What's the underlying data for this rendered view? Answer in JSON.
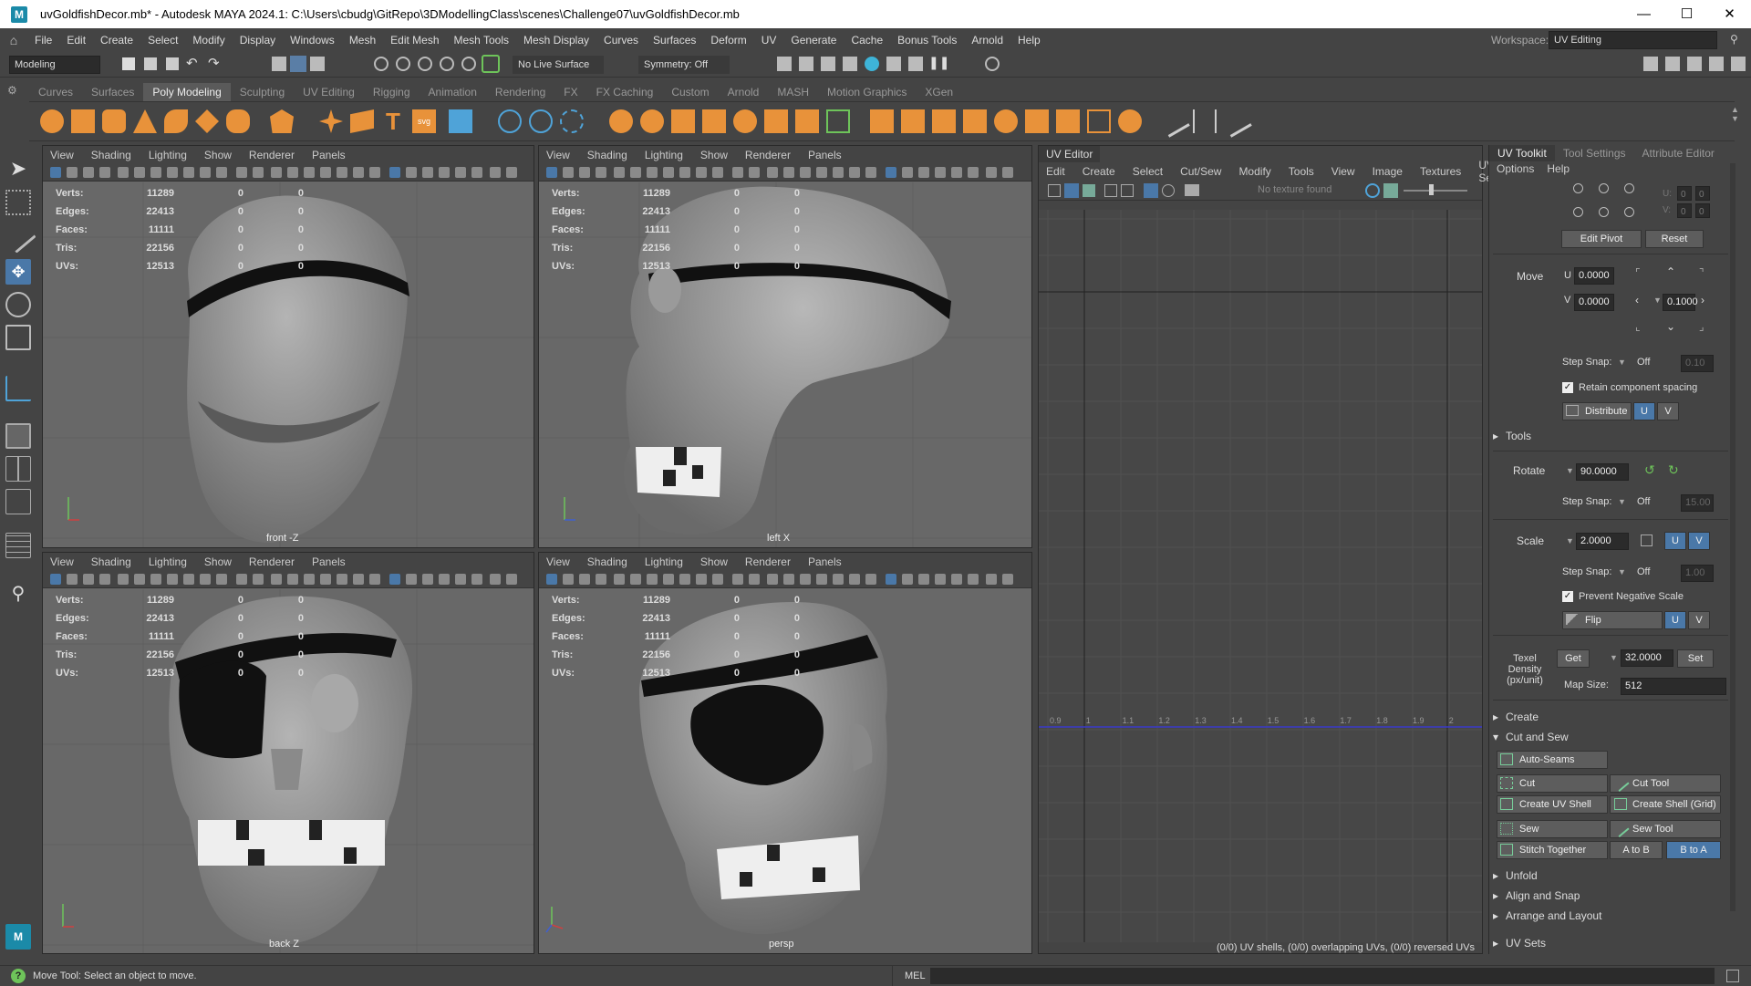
{
  "window": {
    "title": "uvGoldfishDecor.mb* - Autodesk MAYA 2024.1: C:\\Users\\cbudg\\GitRepo\\3DModellingClass\\scenes\\Challenge07\\uvGoldfishDecor.mb",
    "logo": "M"
  },
  "menubar": [
    "File",
    "Edit",
    "Create",
    "Select",
    "Modify",
    "Display",
    "Windows",
    "Mesh",
    "Edit Mesh",
    "Mesh Tools",
    "Mesh Display",
    "Curves",
    "Surfaces",
    "Deform",
    "UV",
    "Generate",
    "Cache",
    "Bonus Tools",
    "Arnold",
    "Help"
  ],
  "workspace": {
    "label": "Workspace:",
    "value": "UV Editing"
  },
  "statusline": {
    "mode": "Modeling",
    "live_surface": "No Live Surface",
    "symmetry": "Symmetry: Off"
  },
  "shelf_tabs": [
    "Curves",
    "Surfaces",
    "Poly Modeling",
    "Sculpting",
    "UV Editing",
    "Rigging",
    "Animation",
    "Rendering",
    "FX",
    "FX Caching",
    "Custom",
    "Arnold",
    "MASH",
    "Motion Graphics",
    "XGen"
  ],
  "shelf_active": "Poly Modeling",
  "viewport_menu": [
    "View",
    "Shading",
    "Lighting",
    "Show",
    "Renderer",
    "Panels"
  ],
  "hud": {
    "rows": [
      {
        "label": "Verts:",
        "value": "11289",
        "a": "0",
        "b": "0"
      },
      {
        "label": "Edges:",
        "value": "22413",
        "a": "0",
        "b": "0"
      },
      {
        "label": "Faces:",
        "value": "11111",
        "a": "0",
        "b": "0"
      },
      {
        "label": "Tris:",
        "value": "22156",
        "a": "0",
        "b": "0"
      },
      {
        "label": "UVs:",
        "value": "12513",
        "a": "0",
        "b": "0"
      }
    ]
  },
  "viewports": [
    {
      "camera": "front -Z"
    },
    {
      "camera": "left X"
    },
    {
      "camera": "back Z"
    },
    {
      "camera": "persp"
    }
  ],
  "uv_editor": {
    "tab": "UV Editor",
    "menu": [
      "Edit",
      "Create",
      "Select",
      "Cut/Sew",
      "Modify",
      "Tools",
      "View",
      "Image",
      "Textures",
      "UV Sets"
    ],
    "texture": "No texture found",
    "axis_labels": [
      "0.9",
      "1",
      "1.1",
      "1.2",
      "1.3",
      "1.4",
      "1.5",
      "1.6",
      "1.7",
      "1.8",
      "1.9",
      "2"
    ],
    "status": "(0/0) UV shells, (0/0) overlapping UVs, (0/0) reversed UVs"
  },
  "uv_toolkit": {
    "tabs": [
      "UV Toolkit",
      "Tool Settings",
      "Attribute Editor"
    ],
    "menu": [
      "Options",
      "Help"
    ],
    "edit_pivot": "Edit Pivot",
    "reset": "Reset",
    "move_label": "Move",
    "u_label": "U",
    "v_label": "V",
    "move_u": "0.0000",
    "move_v": "0.0000",
    "move_step": "0.1000",
    "step_snap_label": "Step Snap:",
    "off": "Off",
    "step_val_1": "0.10",
    "retain_spacing": "Retain component spacing",
    "distribute": "Distribute",
    "tools": "Tools",
    "rotate_label": "Rotate",
    "rotate_val": "90.0000",
    "step_val_2": "15.00",
    "scale_label": "Scale",
    "scale_val": "2.0000",
    "step_val_3": "1.00",
    "prevent_neg": "Prevent Negative Scale",
    "flip": "Flip",
    "texel_label": "Texel Density (px/unit)",
    "get": "Get",
    "texel_val": "32.0000",
    "set": "Set",
    "map_size_label": "Map Size:",
    "map_size": "512",
    "sections": {
      "create": "Create",
      "cut_sew": "Cut and Sew",
      "unfold": "Unfold",
      "align": "Align and Snap",
      "arrange": "Arrange and Layout",
      "uv_sets": "UV Sets"
    },
    "auto_seams": "Auto-Seams",
    "cut": "Cut",
    "cut_tool": "Cut Tool",
    "create_shell": "Create UV Shell",
    "create_shell_grid": "Create Shell (Grid)",
    "sew": "Sew",
    "sew_tool": "Sew Tool",
    "stitch": "Stitch Together",
    "a_to_b": "A to B",
    "b_to_a": "B to A",
    "coord_u": "U:",
    "coord_v": "V:",
    "coord_zero": "0"
  },
  "status_bar": {
    "help": "Move Tool: Select an object to move.",
    "mel": "MEL"
  },
  "colors": {
    "accent_orange": "#e8923a",
    "selection_blue": "#4a78a8",
    "uv_axis": "#3a3ac8"
  }
}
